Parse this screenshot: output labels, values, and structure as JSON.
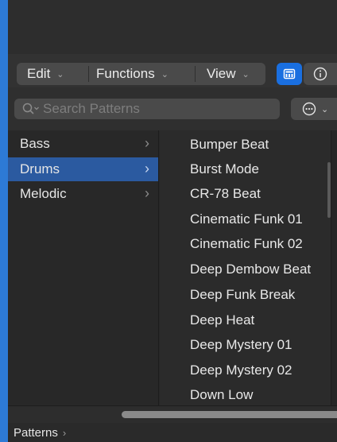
{
  "toolbar": {
    "edit_label": "Edit",
    "functions_label": "Functions",
    "view_label": "View"
  },
  "search": {
    "placeholder": "Search Patterns"
  },
  "categories": [
    {
      "label": "Bass",
      "selected": false
    },
    {
      "label": "Drums",
      "selected": true
    },
    {
      "label": "Melodic",
      "selected": false
    }
  ],
  "patterns": [
    "Bumper Beat",
    "Burst Mode",
    "CR-78 Beat",
    "Cinematic Funk 01",
    "Cinematic Funk 02",
    "Deep Dembow Beat",
    "Deep Funk Break",
    "Deep Heat",
    "Deep Mystery 01",
    "Deep Mystery 02",
    "Down Low"
  ],
  "path_bar": {
    "root_label": "Patterns"
  },
  "colors": {
    "accent": "#1a6fe0",
    "selection": "#2b5aa0"
  }
}
